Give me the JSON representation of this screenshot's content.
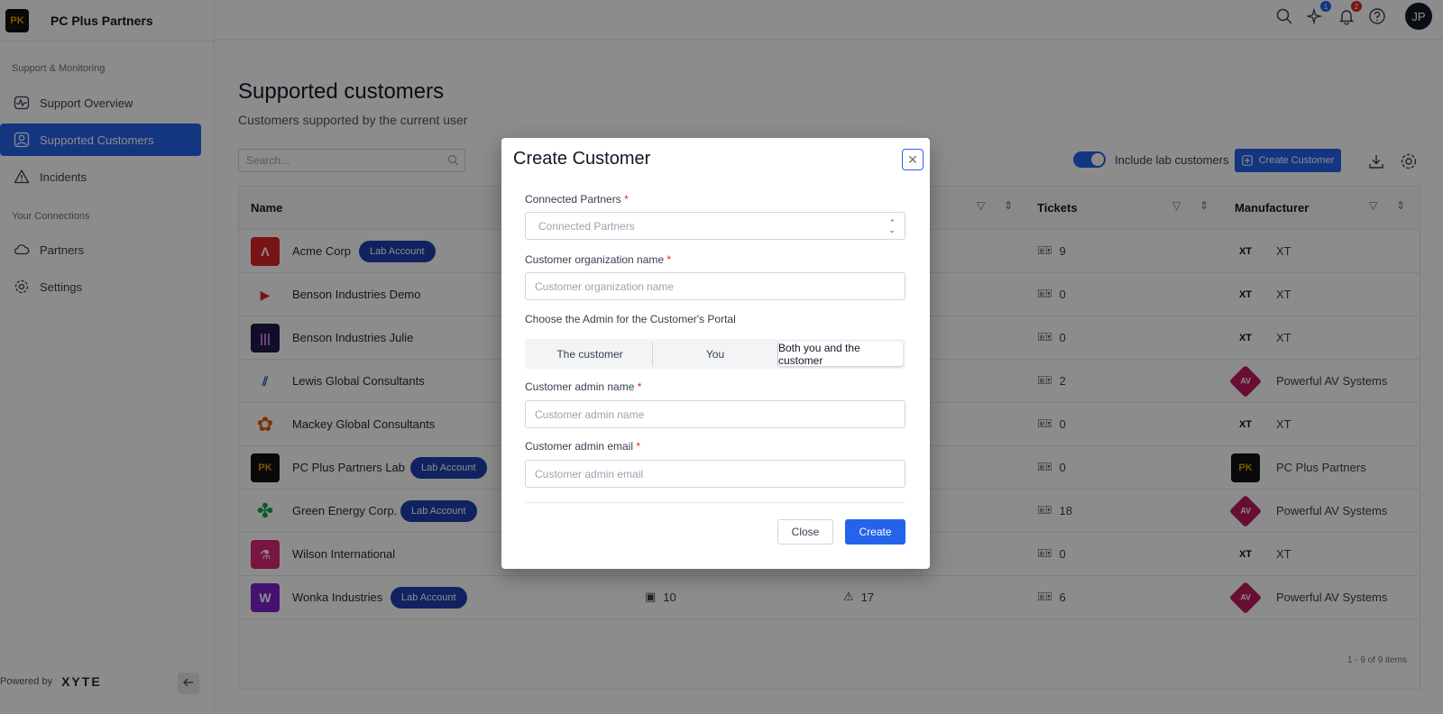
{
  "app": {
    "brand_name": "PC Plus Partners",
    "brand_logo_text": "PK"
  },
  "sidebar": {
    "section_support": "Support & Monitoring",
    "section_connections": "Your Connections",
    "items": [
      {
        "label": "Support Overview",
        "icon": "chart-line-icon"
      },
      {
        "label": "Supported Customers",
        "icon": "user-circle-icon",
        "active": true
      },
      {
        "label": "Incidents",
        "icon": "warning-icon"
      },
      {
        "label": "Partners",
        "icon": "cloud-icon"
      },
      {
        "label": "Settings",
        "icon": "gear-icon"
      }
    ],
    "powered_by": "Powered by",
    "powered_brand": "XYTE"
  },
  "topbar": {
    "ai_badge": "1",
    "notifications_badge": "2",
    "avatar_initials": "JP"
  },
  "main": {
    "title": "Supported customers",
    "subtitle": "Customers supported by the current user",
    "search_placeholder": "Search...",
    "toggle_label": "Include lab customers",
    "create_button": "Create Customer",
    "columns": {
      "name": "Name",
      "tickets": "Tickets",
      "manufacturer": "Manufacturer"
    },
    "lab_badge": "Lab Account",
    "rows": [
      {
        "name": "Acme Corp",
        "lab": true,
        "tickets": "9",
        "manufacturer": "XT"
      },
      {
        "name": "Benson Industries Demo",
        "lab": false,
        "tickets": "0",
        "manufacturer": "XT"
      },
      {
        "name": "Benson Industries Julie",
        "lab": false,
        "tickets": "0",
        "manufacturer": "XT"
      },
      {
        "name": "Lewis Global Consultants",
        "lab": false,
        "tickets": "2",
        "manufacturer": "Powerful AV Systems"
      },
      {
        "name": "Mackey Global Consultants",
        "lab": false,
        "tickets": "0",
        "manufacturer": "XT"
      },
      {
        "name": "PC Plus Partners Lab",
        "lab": true,
        "tickets": "0",
        "manufacturer": "PC Plus Partners"
      },
      {
        "name": "Green Energy Corp.",
        "lab": true,
        "tickets": "18",
        "manufacturer": "Powerful AV Systems"
      },
      {
        "name": "Wilson International",
        "lab": false,
        "tickets": "0",
        "manufacturer": "XT"
      },
      {
        "name": "Wonka Industries",
        "lab": true,
        "devices": "10",
        "incidents": "17",
        "tickets": "6",
        "manufacturer": "Powerful AV Systems"
      }
    ],
    "pagination": "1 - 9 of 9 items"
  },
  "modal": {
    "title": "Create Customer",
    "connected_partners_label": "Connected Partners",
    "connected_partners_placeholder": "Connected Partners",
    "org_name_label": "Customer organization name",
    "org_name_placeholder": "Customer organization name",
    "admin_choice_label": "Choose the Admin for the Customer's Portal",
    "admin_options": [
      "The customer",
      "You",
      "Both you and the customer"
    ],
    "admin_selected": "Both you and the customer",
    "admin_name_label": "Customer admin name",
    "admin_name_placeholder": "Customer admin name",
    "admin_email_label": "Customer admin email",
    "admin_email_placeholder": "Customer admin email",
    "required_mark": "*",
    "close_button": "Close",
    "create_button": "Create"
  },
  "colors": {
    "accent": "#2563eb",
    "lab_badge": "#1e40af",
    "required": "#dc2626",
    "overlay": "rgba(0,0,0,0.45)"
  }
}
